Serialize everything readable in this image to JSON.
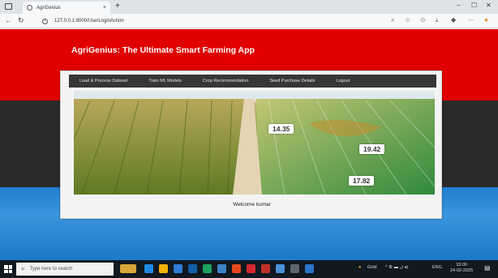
{
  "browser": {
    "tab_title": "AgriGenius",
    "tab_close": "×",
    "new_tab": "+",
    "url": "127.0.0.1:8000/UserLoginAction",
    "controls": {
      "minimize": "–",
      "maximize": "☐",
      "close": "✕"
    }
  },
  "app": {
    "title": "AgriGenius: The Ultimate Smart Farming App",
    "menu": [
      "Load & Process Dataset",
      "Train ML Models",
      "Crop Recommendation",
      "Seed Purchase Details",
      "Logout"
    ],
    "banner_values": [
      "14.35",
      "19.42",
      "17.82"
    ],
    "welcome": "Welcome kumar"
  },
  "taskbar": {
    "search_placeholder": "Type here to search",
    "weather": "Gold",
    "lang": "ENG",
    "time": "15:00",
    "date": "24-02-2025"
  },
  "colors": {
    "header_red": "#e00000",
    "band_dark": "#2a2a2a",
    "band_blue": "#1f7fd0",
    "menu_bg": "#363636"
  }
}
